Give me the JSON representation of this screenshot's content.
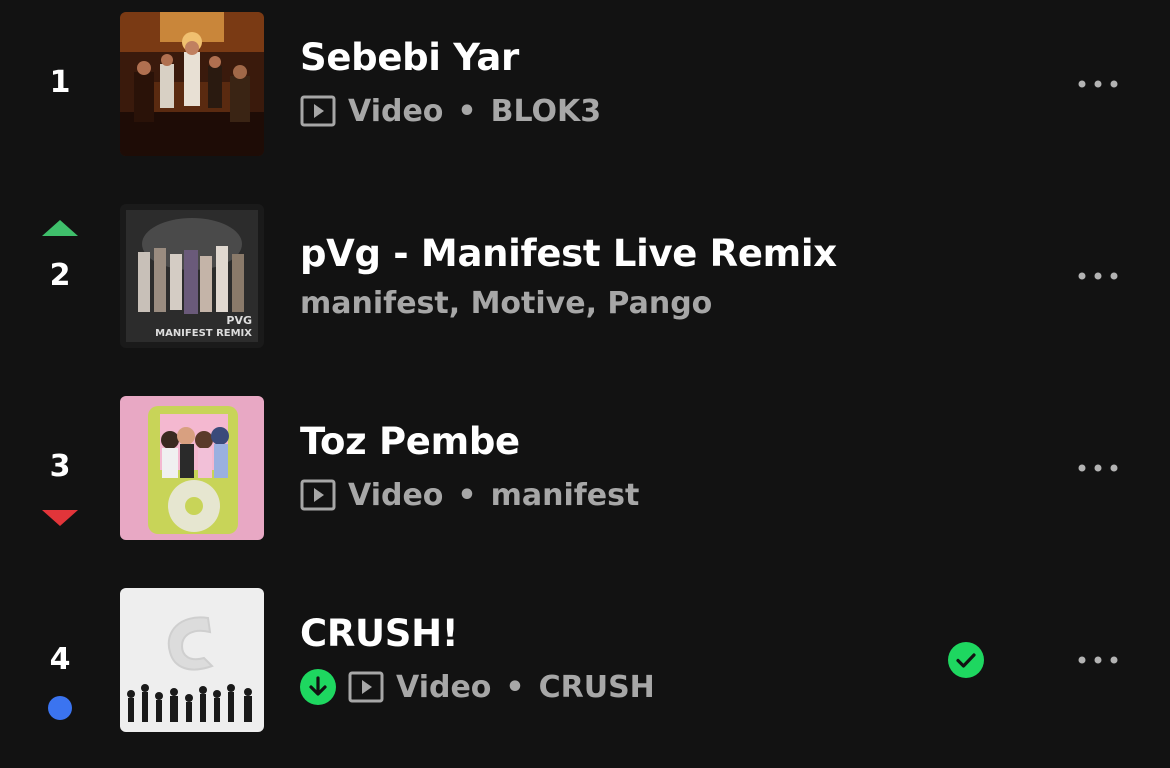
{
  "tracks": [
    {
      "rank": "1",
      "trend": "none",
      "title": "Sebebi Yar",
      "type_label": "Video",
      "separator": "•",
      "artists": "BLOK3",
      "downloaded": false,
      "liked": false
    },
    {
      "rank": "2",
      "trend": "up",
      "title": "pVg - Manifest Live Remix",
      "artists": "manifest, Motive, Pango",
      "downloaded": false,
      "liked": false,
      "cover_text": "PVG",
      "cover_subtext": "MANIFEST REMIX"
    },
    {
      "rank": "3",
      "trend": "down",
      "title": "Toz Pembe",
      "type_label": "Video",
      "separator": "•",
      "artists": "manifest",
      "downloaded": false,
      "liked": false
    },
    {
      "rank": "4",
      "trend": "new",
      "title": "CRUSH!",
      "type_label": "Video",
      "separator": "•",
      "artists": "CRUSH",
      "downloaded": true,
      "liked": true
    }
  ],
  "colors": {
    "background": "#121212",
    "trend_up": "#3fbf6b",
    "trend_down": "#e2353a",
    "new_indicator": "#3b74f0",
    "accent_green": "#1ed760",
    "secondary_text": "#a7a7a7"
  }
}
